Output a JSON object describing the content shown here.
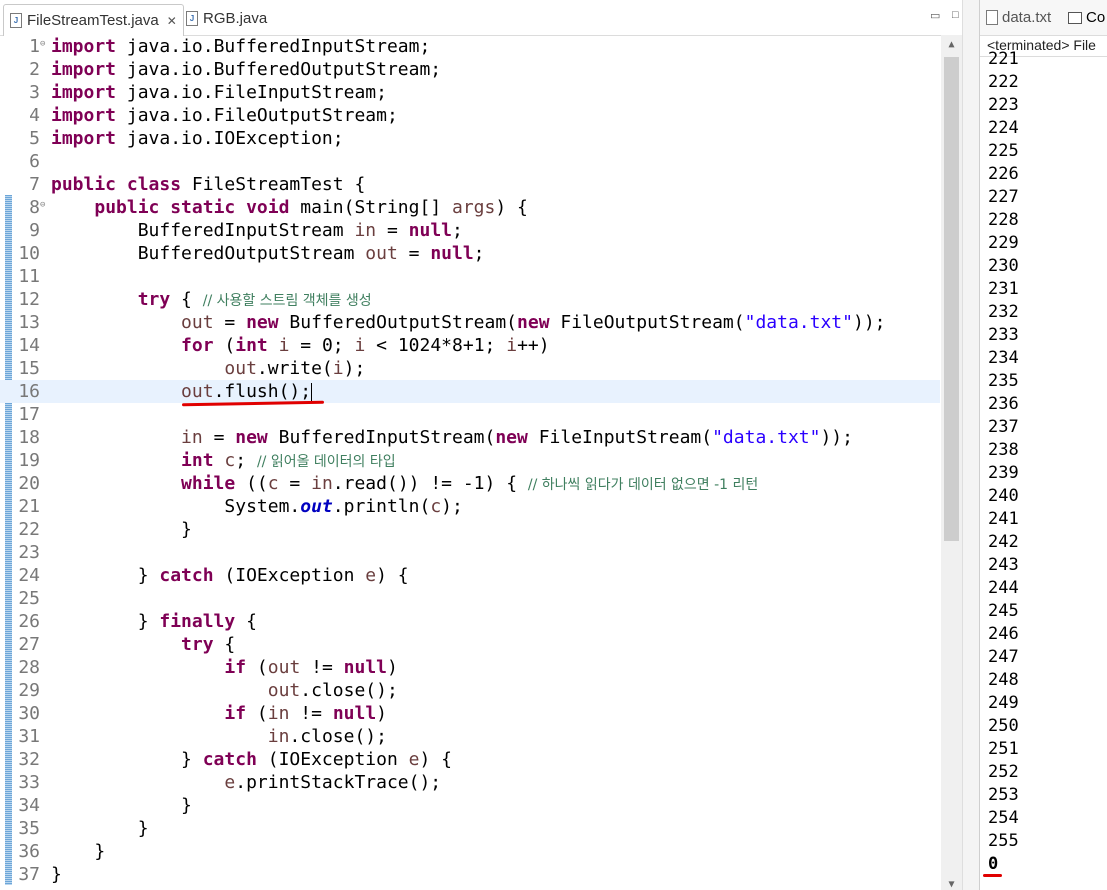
{
  "editor": {
    "tabs": [
      {
        "label": "FileStreamTest.java",
        "active": true,
        "closable": true
      },
      {
        "label": "RGB.java",
        "active": false,
        "closable": false
      }
    ],
    "window_buttons": [
      "minimize",
      "maximize"
    ],
    "lines": [
      {
        "n": "1",
        "fold": "⊖",
        "html": "<span class='kw'>import</span> java.io.BufferedInputStream;"
      },
      {
        "n": "2",
        "html": "<span class='kw'>import</span> java.io.BufferedOutputStream;"
      },
      {
        "n": "3",
        "html": "<span class='kw'>import</span> java.io.FileInputStream;"
      },
      {
        "n": "4",
        "html": "<span class='kw'>import</span> java.io.FileOutputStream;"
      },
      {
        "n": "5",
        "html": "<span class='kw'>import</span> java.io.IOException;"
      },
      {
        "n": "6",
        "html": ""
      },
      {
        "n": "7",
        "html": "<span class='kw'>public class</span> FileStreamTest {"
      },
      {
        "n": "8",
        "fold": "⊖",
        "html": "    <span class='kw'>public static void</span> main(String[] <span class='var'>args</span>) {"
      },
      {
        "n": "9",
        "html": "        BufferedInputStream <span class='var'>in</span> = <span class='kw'>null</span>;"
      },
      {
        "n": "10",
        "html": "        BufferedOutputStream <span class='var'>out</span> = <span class='kw'>null</span>;"
      },
      {
        "n": "11",
        "html": ""
      },
      {
        "n": "12",
        "html": "        <span class='kw'>try</span> { <span class='cmt'>// 사용할 스트림 객체를 생성</span>"
      },
      {
        "n": "13",
        "html": "            <span class='var'>out</span> = <span class='kw'>new</span> BufferedOutputStream(<span class='kw'>new</span> FileOutputStream(<span class='str'>\"data.txt\"</span>));"
      },
      {
        "n": "14",
        "html": "            <span class='kw'>for</span> (<span class='kw'>int</span> <span class='var'>i</span> = 0; <span class='var'>i</span> &lt; 1024*8+1; <span class='var'>i</span>++)"
      },
      {
        "n": "15",
        "html": "                <span class='var'>out</span>.write(<span class='var'>i</span>);"
      },
      {
        "n": "16",
        "current": true,
        "html": "            <span class='var'>out</span>.flush();<span class='caret'></span>"
      },
      {
        "n": "17",
        "html": ""
      },
      {
        "n": "18",
        "html": "            <span class='var'>in</span> = <span class='kw'>new</span> BufferedInputStream(<span class='kw'>new</span> FileInputStream(<span class='str'>\"data.txt\"</span>));"
      },
      {
        "n": "19",
        "html": "            <span class='kw'>int</span> <span class='var'>c</span>; <span class='cmt'>// 읽어올 데이터의 타입</span>"
      },
      {
        "n": "20",
        "html": "            <span class='kw'>while</span> ((<span class='var'>c</span> = <span class='var'>in</span>.read()) != -1) { <span class='cmt'>// 하나씩 읽다가 데이터 없으면 -1 리턴</span>"
      },
      {
        "n": "21",
        "html": "                System.<span class='fld'>out</span>.println(<span class='var'>c</span>);"
      },
      {
        "n": "22",
        "html": "            }"
      },
      {
        "n": "23",
        "html": ""
      },
      {
        "n": "24",
        "html": "        } <span class='kw'>catch</span> (IOException <span class='var'>e</span>) {"
      },
      {
        "n": "25",
        "html": ""
      },
      {
        "n": "26",
        "html": "        } <span class='kw'>finally</span> {"
      },
      {
        "n": "27",
        "html": "            <span class='kw'>try</span> {"
      },
      {
        "n": "28",
        "html": "                <span class='kw'>if</span> (<span class='var'>out</span> != <span class='kw'>null</span>)"
      },
      {
        "n": "29",
        "html": "                    <span class='var'>out</span>.close();"
      },
      {
        "n": "30",
        "html": "                <span class='kw'>if</span> (<span class='var'>in</span> != <span class='kw'>null</span>)"
      },
      {
        "n": "31",
        "html": "                    <span class='var'>in</span>.close();"
      },
      {
        "n": "32",
        "html": "            } <span class='kw'>catch</span> (IOException <span class='var'>e</span>) {"
      },
      {
        "n": "33",
        "html": "                <span class='var'>e</span>.printStackTrace();"
      },
      {
        "n": "34",
        "html": "            }"
      },
      {
        "n": "35",
        "html": "        }"
      },
      {
        "n": "36",
        "html": "    }"
      },
      {
        "n": "37",
        "html": "}"
      }
    ]
  },
  "console": {
    "tabs": [
      {
        "label": "data.txt"
      },
      {
        "label": "Co"
      }
    ],
    "status": "<terminated> File",
    "output": [
      "221",
      "222",
      "223",
      "224",
      "225",
      "226",
      "227",
      "228",
      "229",
      "230",
      "231",
      "232",
      "233",
      "234",
      "235",
      "236",
      "237",
      "238",
      "239",
      "240",
      "241",
      "242",
      "243",
      "244",
      "245",
      "246",
      "247",
      "248",
      "249",
      "250",
      "251",
      "252",
      "253",
      "254",
      "255",
      "0"
    ]
  },
  "colors": {
    "keyword": "#7f0055",
    "string": "#2a00ff",
    "comment": "#3f7f5f",
    "local_variable": "#6a3e3e",
    "annotation_mark": "#e00000",
    "current_line": "#e8f2fe"
  }
}
